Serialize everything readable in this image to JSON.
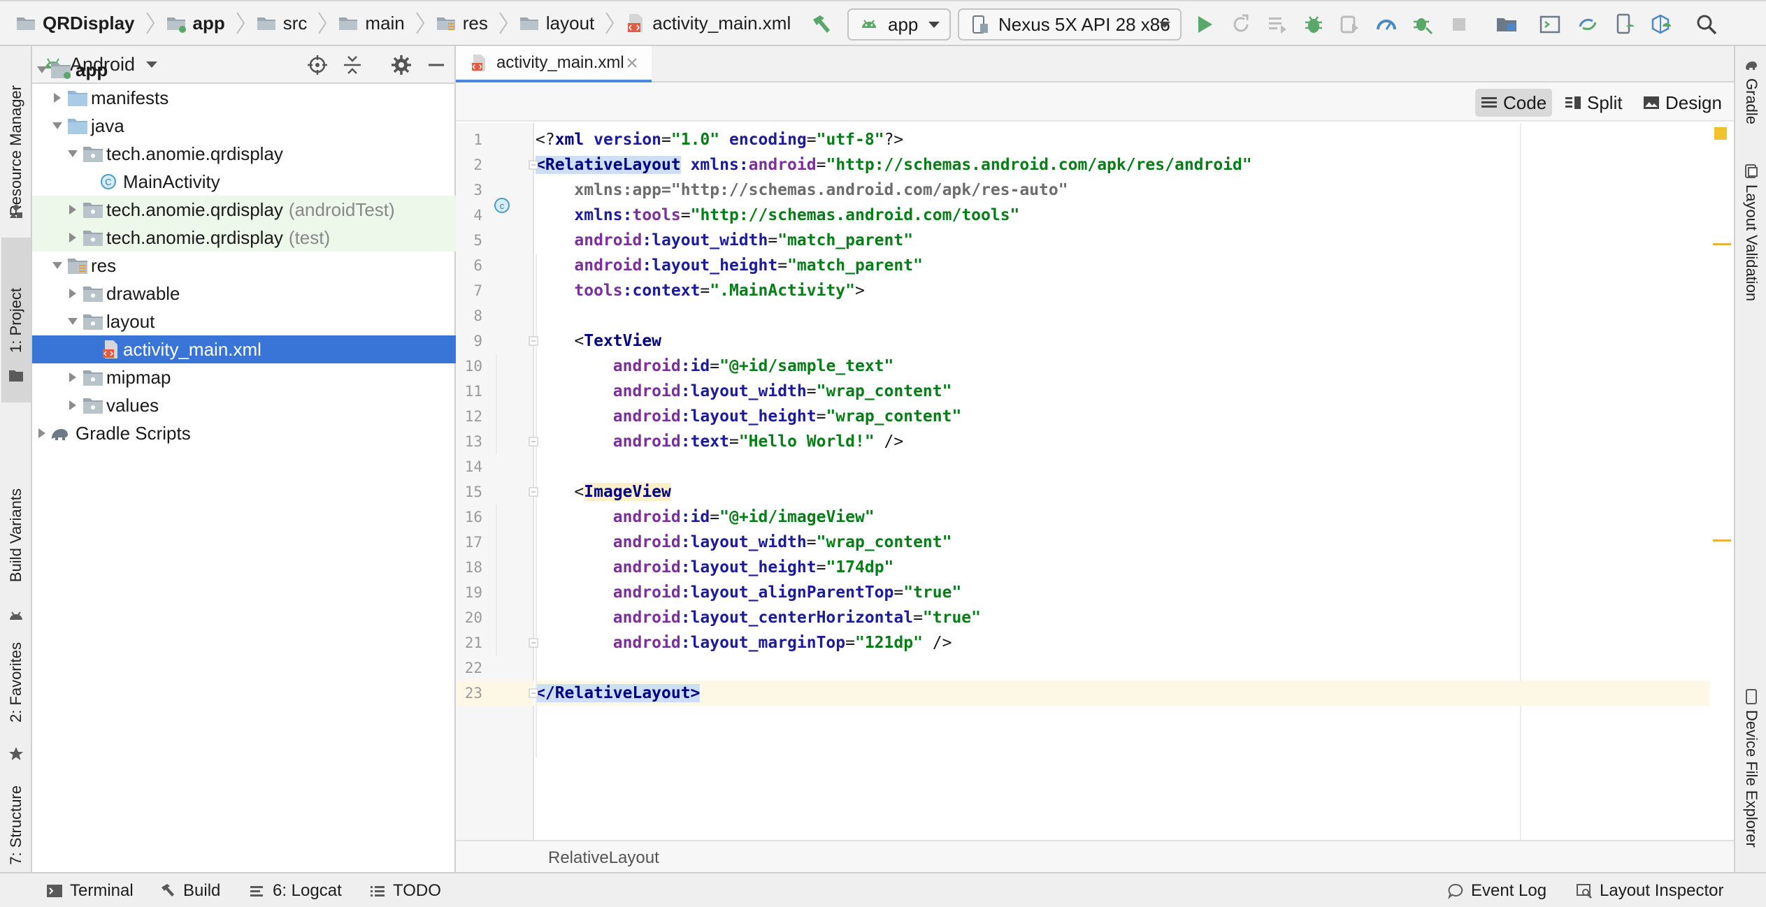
{
  "toolbar": {
    "breadcrumb": [
      "QRDisplay",
      "app",
      "src",
      "main",
      "res",
      "layout",
      "activity_main.xml"
    ],
    "run_config": "app",
    "device": "Nexus 5X API 28 x86"
  },
  "left_tabs": {
    "resource_manager": "Resource Manager",
    "project": "1: Project",
    "build_variants": "Build Variants",
    "favorites": "2: Favorites",
    "structure": "7: Structure"
  },
  "right_tabs": {
    "gradle": "Gradle",
    "layout_validation": "Layout Validation",
    "device_file_explorer": "Device File Explorer"
  },
  "project": {
    "view_name": "Android",
    "tree": [
      {
        "label": "app",
        "suffix": ""
      },
      {
        "label": "manifests",
        "suffix": ""
      },
      {
        "label": "java",
        "suffix": ""
      },
      {
        "label": "tech.anomie.qrdisplay",
        "suffix": ""
      },
      {
        "label": "MainActivity",
        "suffix": ""
      },
      {
        "label": "tech.anomie.qrdisplay",
        "suffix": "(androidTest)"
      },
      {
        "label": "tech.anomie.qrdisplay",
        "suffix": "(test)"
      },
      {
        "label": "res",
        "suffix": ""
      },
      {
        "label": "drawable",
        "suffix": ""
      },
      {
        "label": "layout",
        "suffix": ""
      },
      {
        "label": "activity_main.xml",
        "suffix": ""
      },
      {
        "label": "mipmap",
        "suffix": ""
      },
      {
        "label": "values",
        "suffix": ""
      },
      {
        "label": "Gradle Scripts",
        "suffix": ""
      }
    ]
  },
  "editor": {
    "tab_title": "activity_main.xml",
    "view_modes": [
      "Code",
      "Split",
      "Design"
    ],
    "active_mode": "Code",
    "status_crumb": "RelativeLayout",
    "lines": [
      [
        [
          "p",
          "<?"
        ],
        [
          "tag",
          "xml "
        ],
        [
          "attr",
          "version"
        ],
        [
          "p",
          "="
        ],
        [
          "val",
          "\"1.0\""
        ],
        [
          "p",
          " "
        ],
        [
          "attr",
          "encoding"
        ],
        [
          "p",
          "="
        ],
        [
          "val",
          "\"utf-8\""
        ],
        [
          "p",
          "?>"
        ]
      ],
      [
        [
          "tagm",
          "<RelativeLayout"
        ],
        [
          "p",
          " "
        ],
        [
          "attr",
          "xmlns:"
        ],
        [
          "ns",
          "android"
        ],
        [
          "p",
          "="
        ],
        [
          "val",
          "\"http://schemas.android.com/apk/res/android\""
        ]
      ],
      [
        [
          "p",
          "    "
        ],
        [
          "pl",
          "xmlns:app=\"http://schemas.android.com/apk/res-auto\""
        ]
      ],
      [
        [
          "p",
          "    "
        ],
        [
          "attr",
          "xmlns:"
        ],
        [
          "ns",
          "tools"
        ],
        [
          "p",
          "="
        ],
        [
          "val",
          "\"http://schemas.android.com/tools\""
        ]
      ],
      [
        [
          "p",
          "    "
        ],
        [
          "ns",
          "android"
        ],
        [
          "attr",
          ":layout_width"
        ],
        [
          "p",
          "="
        ],
        [
          "val",
          "\"match_parent\""
        ]
      ],
      [
        [
          "p",
          "    "
        ],
        [
          "ns",
          "android"
        ],
        [
          "attr",
          ":layout_height"
        ],
        [
          "p",
          "="
        ],
        [
          "val",
          "\"match_parent\""
        ]
      ],
      [
        [
          "p",
          "    "
        ],
        [
          "ns",
          "tools"
        ],
        [
          "attr",
          ":context"
        ],
        [
          "p",
          "="
        ],
        [
          "val",
          "\".MainActivity\""
        ],
        [
          "p",
          ">"
        ]
      ],
      [],
      [
        [
          "p",
          "    <"
        ],
        [
          "tag",
          "TextView"
        ]
      ],
      [
        [
          "p",
          "        "
        ],
        [
          "ns",
          "android"
        ],
        [
          "attr",
          ":id"
        ],
        [
          "p",
          "="
        ],
        [
          "val",
          "\"@+id/sample_text\""
        ]
      ],
      [
        [
          "p",
          "        "
        ],
        [
          "ns",
          "android"
        ],
        [
          "attr",
          ":layout_width"
        ],
        [
          "p",
          "="
        ],
        [
          "val",
          "\"wrap_content\""
        ]
      ],
      [
        [
          "p",
          "        "
        ],
        [
          "ns",
          "android"
        ],
        [
          "attr",
          ":layout_height"
        ],
        [
          "p",
          "="
        ],
        [
          "val",
          "\"wrap_content\""
        ]
      ],
      [
        [
          "p",
          "        "
        ],
        [
          "ns",
          "android"
        ],
        [
          "attr",
          ":text"
        ],
        [
          "p",
          "="
        ],
        [
          "val",
          "\"Hello World!\""
        ],
        [
          "p",
          " />"
        ]
      ],
      [],
      [
        [
          "p",
          "    <"
        ],
        [
          "tagh",
          "ImageView"
        ]
      ],
      [
        [
          "p",
          "        "
        ],
        [
          "ns",
          "android"
        ],
        [
          "attr",
          ":id"
        ],
        [
          "p",
          "="
        ],
        [
          "val",
          "\"@+id/imageView\""
        ]
      ],
      [
        [
          "p",
          "        "
        ],
        [
          "ns",
          "android"
        ],
        [
          "attr",
          ":layout_width"
        ],
        [
          "p",
          "="
        ],
        [
          "val",
          "\"wrap_content\""
        ]
      ],
      [
        [
          "p",
          "        "
        ],
        [
          "ns",
          "android"
        ],
        [
          "attr",
          ":layout_height"
        ],
        [
          "p",
          "="
        ],
        [
          "val",
          "\"174dp\""
        ]
      ],
      [
        [
          "p",
          "        "
        ],
        [
          "ns",
          "android"
        ],
        [
          "attr",
          ":layout_alignParentTop"
        ],
        [
          "p",
          "="
        ],
        [
          "val",
          "\"true\""
        ]
      ],
      [
        [
          "p",
          "        "
        ],
        [
          "ns",
          "android"
        ],
        [
          "attr",
          ":layout_centerHorizontal"
        ],
        [
          "p",
          "="
        ],
        [
          "val",
          "\"true\""
        ]
      ],
      [
        [
          "p",
          "        "
        ],
        [
          "ns",
          "android"
        ],
        [
          "attr",
          ":layout_marginTop"
        ],
        [
          "p",
          "="
        ],
        [
          "val",
          "\"121dp\""
        ],
        [
          "p",
          " />"
        ]
      ],
      [],
      [
        [
          "tagm",
          "</RelativeLayout>"
        ]
      ]
    ],
    "current_line": 23
  },
  "bottom_bar": {
    "terminal": "Terminal",
    "build": "Build",
    "logcat": "6: Logcat",
    "todo": "TODO",
    "event_log": "Event Log",
    "layout_inspector": "Layout Inspector"
  },
  "colors": {
    "selection": "#3875d7",
    "run": "#59a869",
    "tab_underline": "#4a88e0",
    "test_highlight": "#eef8ea"
  }
}
